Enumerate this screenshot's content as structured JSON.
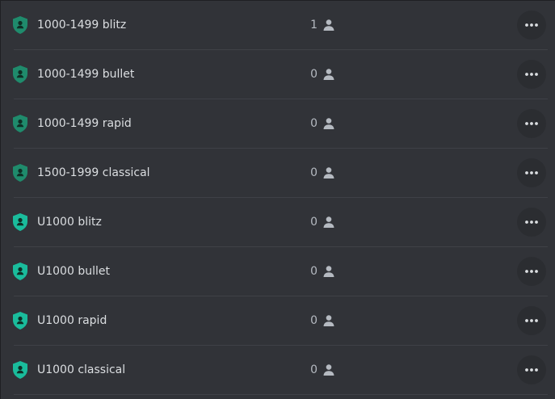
{
  "roles": [
    {
      "name": "1000-1499 blitz",
      "members": "1",
      "shield_color": "#1f8b6c",
      "shield_icon": "shield-person-icon",
      "member_icon": "person-icon",
      "more_icon": "more-horizontal-icon"
    },
    {
      "name": "1000-1499 bullet",
      "members": "0",
      "shield_color": "#1f8b6c",
      "shield_icon": "shield-person-icon",
      "member_icon": "person-icon",
      "more_icon": "more-horizontal-icon"
    },
    {
      "name": "1000-1499 rapid",
      "members": "0",
      "shield_color": "#1f8b6c",
      "shield_icon": "shield-person-icon",
      "member_icon": "person-icon",
      "more_icon": "more-horizontal-icon"
    },
    {
      "name": "1500-1999 classical",
      "members": "0",
      "shield_color": "#1f8b6c",
      "shield_icon": "shield-person-icon",
      "member_icon": "person-icon",
      "more_icon": "more-horizontal-icon"
    },
    {
      "name": "U1000 blitz",
      "members": "0",
      "shield_color": "#1abc9c",
      "shield_icon": "shield-person-icon",
      "member_icon": "person-icon",
      "more_icon": "more-horizontal-icon"
    },
    {
      "name": "U1000 bullet",
      "members": "0",
      "shield_color": "#1abc9c",
      "shield_icon": "shield-person-icon",
      "member_icon": "person-icon",
      "more_icon": "more-horizontal-icon"
    },
    {
      "name": "U1000 rapid",
      "members": "0",
      "shield_color": "#1abc9c",
      "shield_icon": "shield-person-icon",
      "member_icon": "person-icon",
      "more_icon": "more-horizontal-icon"
    },
    {
      "name": "U1000 classical",
      "members": "0",
      "shield_color": "#1abc9c",
      "shield_icon": "shield-person-icon",
      "member_icon": "person-icon",
      "more_icon": "more-horizontal-icon"
    }
  ]
}
